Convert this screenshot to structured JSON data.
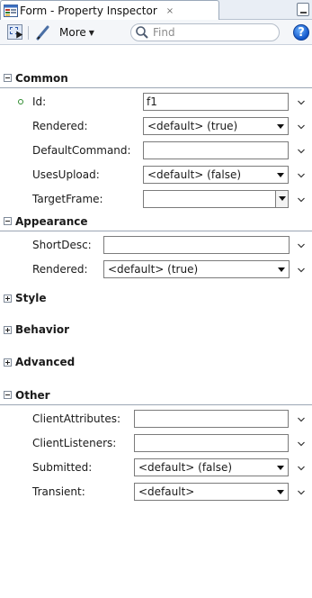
{
  "tab": {
    "title": "Form - Property Inspector",
    "close_label": "×"
  },
  "toolbar": {
    "more_label": "More",
    "find_placeholder": "Find",
    "help_label": "?"
  },
  "groups": {
    "common": {
      "title": "Common",
      "expanded": true,
      "properties": [
        {
          "label": "Id:",
          "value": "f1",
          "control": "text",
          "marked": true
        },
        {
          "label": "Rendered:",
          "value": "<default> (true)",
          "control": "select"
        },
        {
          "label": "DefaultCommand:",
          "value": "",
          "control": "text"
        },
        {
          "label": "UsesUpload:",
          "value": "<default> (false)",
          "control": "select"
        },
        {
          "label": "TargetFrame:",
          "value": "",
          "control": "combo"
        }
      ]
    },
    "appearance": {
      "title": "Appearance",
      "expanded": true,
      "properties": [
        {
          "label": "ShortDesc:",
          "value": "",
          "control": "text"
        },
        {
          "label": "Rendered:",
          "value": "<default> (true)",
          "control": "select"
        }
      ]
    },
    "style": {
      "title": "Style",
      "expanded": false
    },
    "behavior": {
      "title": "Behavior",
      "expanded": false
    },
    "advanced": {
      "title": "Advanced",
      "expanded": false
    },
    "other": {
      "title": "Other",
      "expanded": true,
      "properties": [
        {
          "label": "ClientAttributes:",
          "value": "",
          "control": "text"
        },
        {
          "label": "ClientListeners:",
          "value": "",
          "control": "text"
        },
        {
          "label": "Submitted:",
          "value": "<default> (false)",
          "control": "select"
        },
        {
          "label": "Transient:",
          "value": "<default>",
          "control": "select"
        }
      ]
    }
  },
  "colors": {
    "tab_strip": "#e9eef5",
    "toolbar": "#f4f6f9",
    "marker_green": "#2e8b2e",
    "help_blue": "#1155c9"
  },
  "icons": [
    "property-inspector-icon",
    "select-icon",
    "pencil-icon",
    "search-icon",
    "help-icon",
    "chevron-down-icon"
  ]
}
